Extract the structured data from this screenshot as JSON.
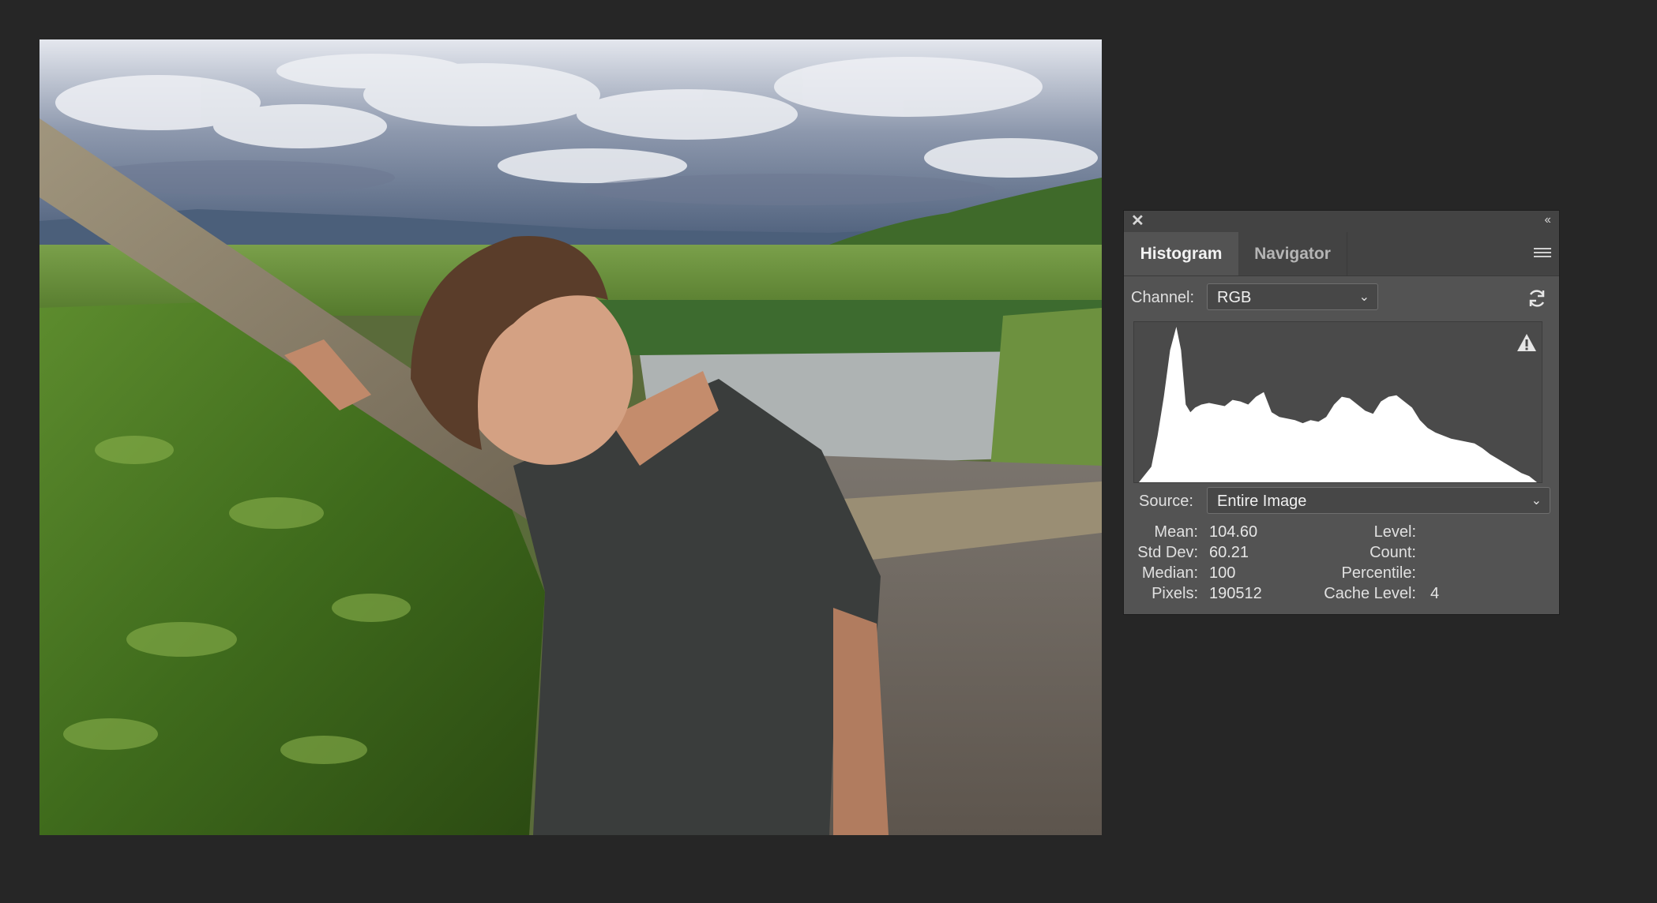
{
  "panel": {
    "close_icon": "close-icon",
    "collapse_icon": "double-chevron-left-icon",
    "tabs": [
      {
        "label": "Histogram",
        "active": true
      },
      {
        "label": "Navigator",
        "active": false
      }
    ],
    "menu_icon": "hamburger-menu-icon",
    "channel": {
      "label": "Channel:",
      "value": "RGB"
    },
    "refresh_icon": "refresh-icon",
    "warning_icon": "warning-triangle-icon",
    "source": {
      "label": "Source:",
      "value": "Entire Image"
    },
    "stats": {
      "mean_label": "Mean:",
      "mean": "104.60",
      "stddev_label": "Std Dev:",
      "stddev": "60.21",
      "median_label": "Median:",
      "median": "100",
      "pixels_label": "Pixels:",
      "pixels": "190512",
      "level_label": "Level:",
      "level": "",
      "count_label": "Count:",
      "count": "",
      "percentile_label": "Percentile:",
      "percentile": "",
      "cache_label": "Cache Level:",
      "cache": "4"
    }
  },
  "colors": {
    "background": "#262626",
    "panel": "#535353",
    "panel_header": "#434343",
    "histogram_fill": "#ffffff"
  },
  "chart_data": {
    "type": "area",
    "xlim": [
      0,
      255
    ],
    "ylim": [
      0,
      1
    ],
    "x": [
      0,
      8,
      12,
      16,
      20,
      24,
      27,
      30,
      33,
      36,
      40,
      45,
      50,
      55,
      60,
      65,
      70,
      75,
      80,
      85,
      90,
      95,
      100,
      105,
      110,
      115,
      120,
      125,
      130,
      135,
      140,
      145,
      150,
      155,
      160,
      165,
      170,
      175,
      180,
      185,
      190,
      195,
      200,
      205,
      210,
      215,
      220,
      225,
      230,
      235,
      240,
      245,
      250,
      255
    ],
    "values": [
      0.0,
      0.1,
      0.3,
      0.55,
      0.85,
      1.0,
      0.85,
      0.5,
      0.45,
      0.48,
      0.5,
      0.51,
      0.5,
      0.49,
      0.53,
      0.52,
      0.5,
      0.55,
      0.58,
      0.45,
      0.42,
      0.41,
      0.4,
      0.38,
      0.4,
      0.39,
      0.42,
      0.5,
      0.55,
      0.54,
      0.5,
      0.46,
      0.44,
      0.52,
      0.55,
      0.56,
      0.52,
      0.48,
      0.4,
      0.35,
      0.32,
      0.3,
      0.28,
      0.27,
      0.26,
      0.25,
      0.22,
      0.18,
      0.15,
      0.12,
      0.09,
      0.06,
      0.04,
      0.0
    ]
  }
}
